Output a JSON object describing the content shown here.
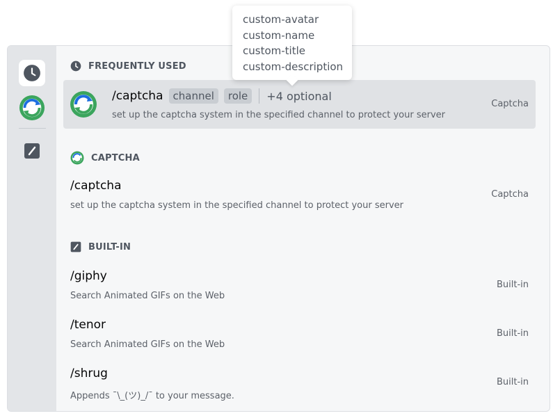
{
  "tooltip": {
    "options": [
      "custom-avatar",
      "custom-name",
      "custom-title",
      "custom-description"
    ]
  },
  "rail": {
    "items": [
      {
        "icon": "clock-icon",
        "active": true
      },
      {
        "icon": "captcha-bot-avatar",
        "active": false
      },
      {
        "icon": "slash-command-icon",
        "active": false
      }
    ]
  },
  "sections": {
    "frequent": {
      "title": "FREQUENTLY USED",
      "icon": "clock-icon",
      "command": {
        "name": "/captcha",
        "options": [
          "channel",
          "role"
        ],
        "more": "+4 optional",
        "description": "set up the captcha system in the specified channel to protect your server",
        "source": "Captcha"
      }
    },
    "captcha": {
      "title": "CAPTCHA",
      "icon": "captcha-bot-avatar",
      "commands": [
        {
          "name": "/captcha",
          "description": "set up the captcha system in the specified channel to protect your server",
          "source": "Captcha"
        }
      ]
    },
    "builtin": {
      "title": "BUILT-IN",
      "icon": "slash-command-icon",
      "commands": [
        {
          "name": "/giphy",
          "description": "Search Animated GIFs on the Web",
          "source": "Built-in"
        },
        {
          "name": "/tenor",
          "description": "Search Animated GIFs on the Web",
          "source": "Built-in"
        },
        {
          "name": "/shrug",
          "description": "Appends ¯\\_(ツ)_/¯ to your message.",
          "source": "Built-in"
        }
      ]
    }
  },
  "colors": {
    "captcha_green": "#3ba55d",
    "captcha_blue": "#1d6fe0",
    "selected_bg": "#e0e2e5"
  }
}
